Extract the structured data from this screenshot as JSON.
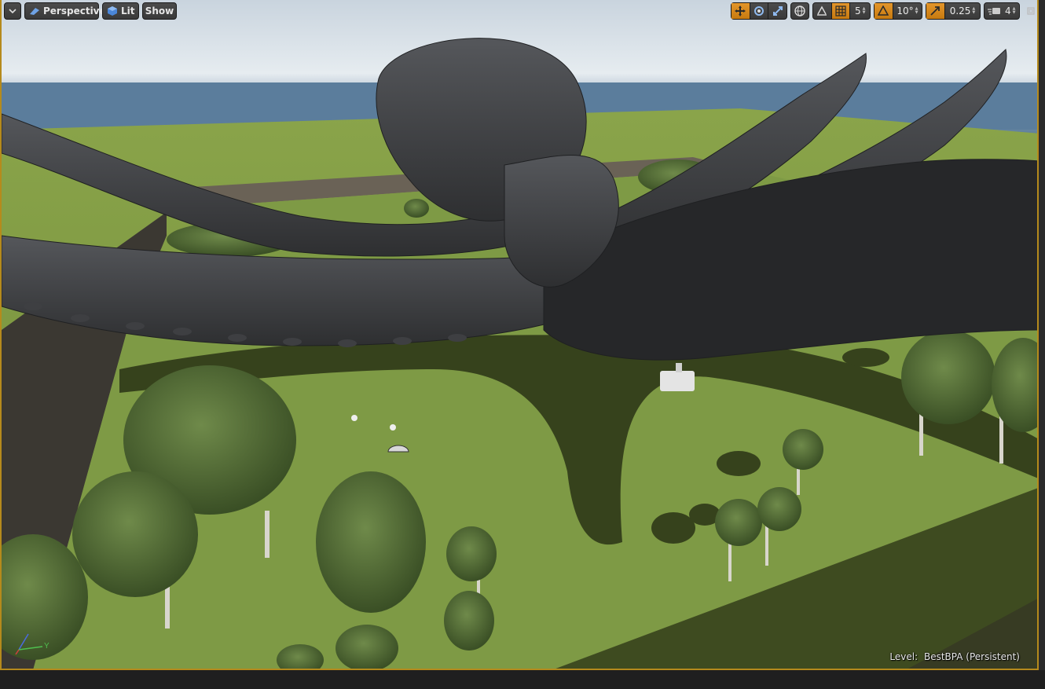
{
  "toolbar_left": {
    "menu_icon": "chevron-down-icon",
    "perspective_label": "Perspective",
    "view_mode_label": "Lit",
    "show_label": "Show"
  },
  "toolbar_right": {
    "grid_snap_value": "5",
    "rotation_snap_value": "10°",
    "scale_snap_value": "0.25",
    "camera_speed_value": "4"
  },
  "status": {
    "level_prefix": "Level:",
    "level_name": "BestBPA (Persistent)"
  },
  "gizmo": {
    "y_label": "Y"
  },
  "colors": {
    "active_orange": "#e3962b",
    "viewport_border": "#b58a1c",
    "grass": "#6d8a3a",
    "octopus": "#3a3b3e"
  }
}
